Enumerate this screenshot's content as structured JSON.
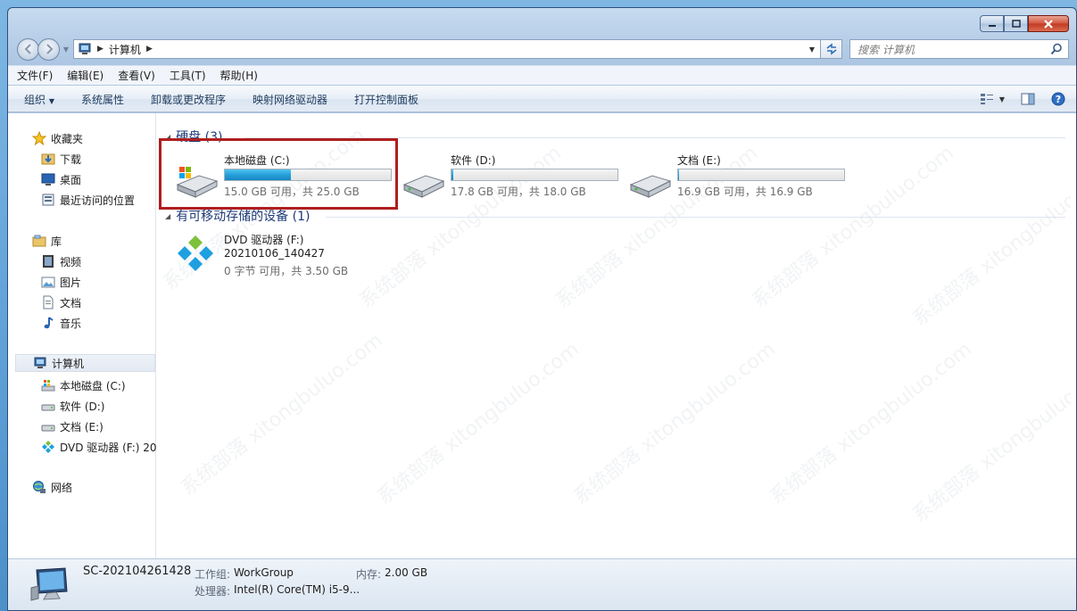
{
  "address": {
    "crumb": "计算机"
  },
  "search": {
    "placeholder": "搜索 计算机"
  },
  "menu": [
    "文件(F)",
    "编辑(E)",
    "查看(V)",
    "工具(T)",
    "帮助(H)"
  ],
  "commands": {
    "organize": "组织",
    "items": [
      "系统属性",
      "卸载或更改程序",
      "映射网络驱动器",
      "打开控制面板"
    ]
  },
  "nav": {
    "favorites": "收藏夹",
    "downloads": "下载",
    "desktop": "桌面",
    "recent": "最近访问的位置",
    "libraries": "库",
    "videos": "视频",
    "pictures": "图片",
    "documents": "文档",
    "music": "音乐",
    "computer": "计算机",
    "drive_c": "本地磁盘 (C:)",
    "drive_d": "软件 (D:)",
    "drive_e": "文档 (E:)",
    "drive_f": "DVD 驱动器 (F:) 20",
    "network": "网络"
  },
  "groups": {
    "hdd": "硬盘 (3)",
    "removable": "有可移动存储的设备 (1)"
  },
  "drives": [
    {
      "name": "本地磁盘 (C:)",
      "size": "15.0 GB 可用，共 25.0 GB",
      "used_fraction": 0.4
    },
    {
      "name": "软件 (D:)",
      "size": "17.8 GB 可用，共 18.0 GB",
      "used_fraction": 0.011
    },
    {
      "name": "文档 (E:)",
      "size": "16.9 GB 可用，共 16.9 GB",
      "used_fraction": 0.005
    }
  ],
  "dvd": {
    "name": "DVD 驱动器 (F:)",
    "label": "20210106_140427",
    "size": "0 字节 可用，共 3.50 GB"
  },
  "details": {
    "computer_name": "SC-202104261428",
    "workgroup_label": "工作组:",
    "workgroup": "WorkGroup",
    "memory_label": "内存:",
    "memory": "2.00 GB",
    "cpu_label": "处理器:",
    "cpu": "Intel(R) Core(TM) i5-9..."
  },
  "colors": {
    "accent": "#26a0da",
    "highlight": "#b01e1e"
  }
}
